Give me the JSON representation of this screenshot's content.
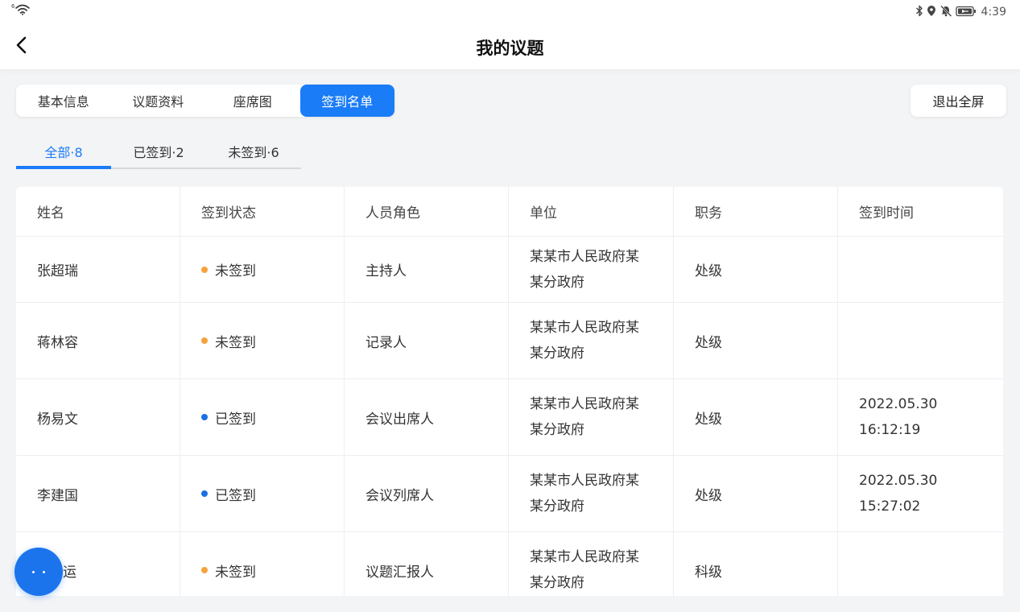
{
  "status_bar": {
    "network_badge": "6",
    "wifi_icon": "wifi-icon",
    "icons": [
      "bluetooth-icon",
      "location-icon",
      "bell-off-icon",
      "battery-charging-icon"
    ],
    "time": "4:39"
  },
  "header": {
    "back_icon": "chevron-left-icon",
    "title": "我的议题"
  },
  "tabs": [
    {
      "label": "基本信息",
      "active": false
    },
    {
      "label": "议题资料",
      "active": false
    },
    {
      "label": "座席图",
      "active": false
    },
    {
      "label": "签到名单",
      "active": true
    }
  ],
  "exit_fullscreen": {
    "label": "退出全屏"
  },
  "filters": [
    {
      "label": "全部·8",
      "active": true
    },
    {
      "label": "已签到·2",
      "active": false
    },
    {
      "label": "未签到·6",
      "active": false
    }
  ],
  "table": {
    "columns": [
      "姓名",
      "签到状态",
      "人员角色",
      "单位",
      "职务",
      "签到时间"
    ],
    "rows": [
      {
        "name": "张超瑞",
        "status": "未签到",
        "status_color": "#f6a23c",
        "role": "主持人",
        "unit": "某某市人民政府某某分政府",
        "rank": "处级",
        "signin_time": ""
      },
      {
        "name": "蒋林容",
        "status": "未签到",
        "status_color": "#f6a23c",
        "role": "记录人",
        "unit": "某某市人民政府某某分政府",
        "rank": "处级",
        "signin_time": ""
      },
      {
        "name": "杨易文",
        "status": "已签到",
        "status_color": "#1b6fe3",
        "role": "会议出席人",
        "unit": "某某市人民政府某某分政府",
        "rank": "处级",
        "signin_time": "2022.05.30 16:12:19"
      },
      {
        "name": "李建国",
        "status": "已签到",
        "status_color": "#1b6fe3",
        "role": "会议列席人",
        "unit": "某某市人民政府某某分政府",
        "rank": "处级",
        "signin_time": "2022.05.30 15:27:02"
      },
      {
        "name": "运",
        "status": "未签到",
        "status_color": "#f6a23c",
        "role": "议题汇报人",
        "unit": "某某市人民政府某某分政府",
        "rank": "科级",
        "signin_time": ""
      }
    ]
  },
  "fab": {
    "icon": "more-dots-icon"
  },
  "colors": {
    "accent": "#1a7cf6",
    "pending": "#f6a23c",
    "signed": "#1b6fe3",
    "background": "#f3f4f6"
  }
}
